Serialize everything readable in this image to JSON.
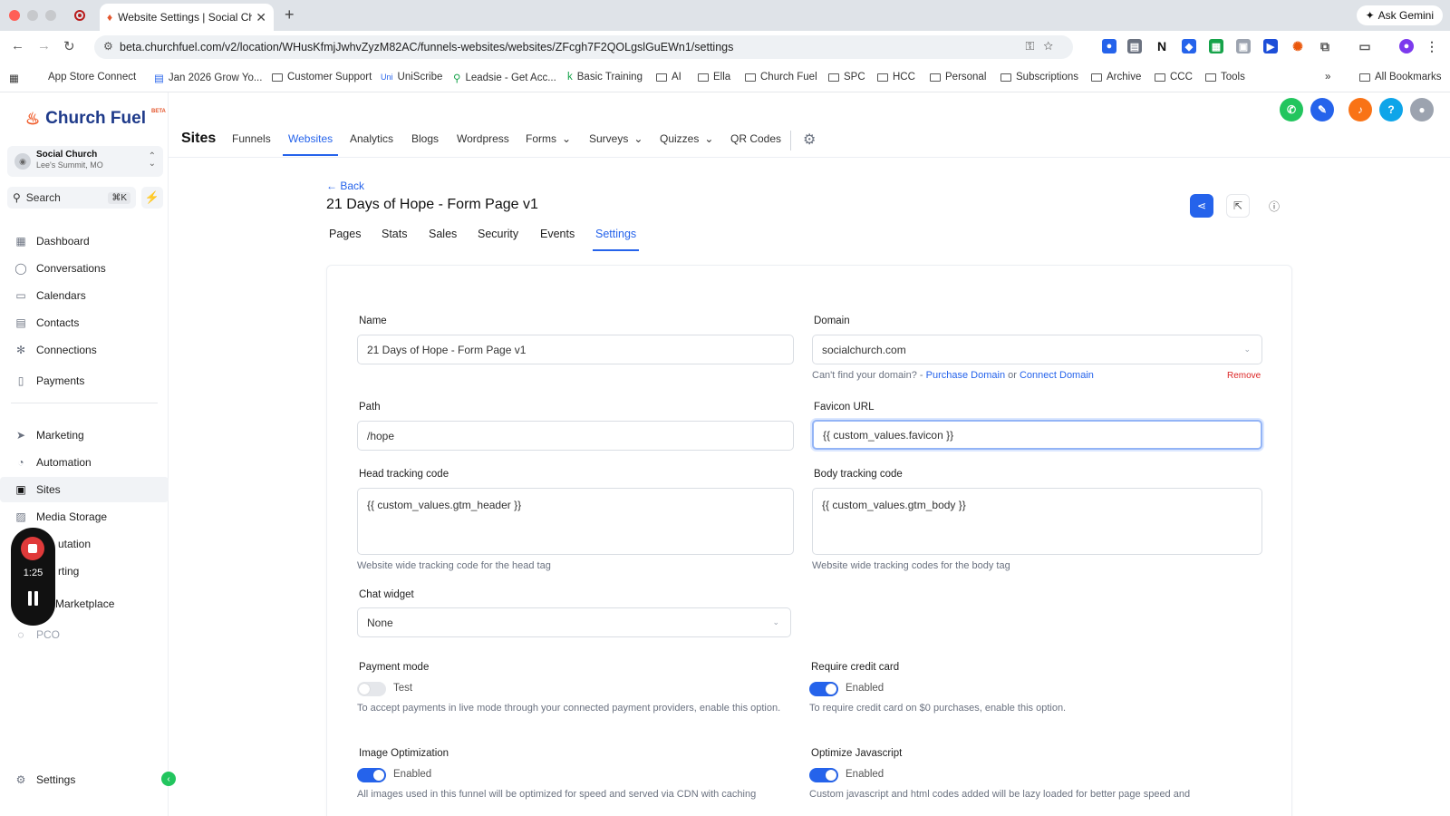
{
  "browser": {
    "tab_title": "Website Settings | Social Ch…",
    "url": "beta.churchfuel.com/v2/location/WHusKfmjJwhvZyzM82AC/funnels-websites/websites/ZFcgh7F2QOLgslGuEWn1/settings",
    "ask_gemini": "Ask Gemini",
    "bookmarks": [
      "App Store Connect",
      "Jan 2026 Grow Yo...",
      "Customer Support",
      "UniScribe",
      "Leadsie - Get Acc...",
      "Basic Training",
      "AI",
      "Ella",
      "Church Fuel",
      "SPC",
      "HCC",
      "Personal",
      "Subscriptions",
      "Archive",
      "CCC",
      "Tools"
    ],
    "all_bookmarks": "All Bookmarks",
    "colors": {
      "close": "#ff5f57",
      "minimize": "#febc2e",
      "maximize": "#28c840"
    }
  },
  "sidebar": {
    "logo": "Church Fuel",
    "logo_badge": "BETA",
    "location_name": "Social Church",
    "location_sub": "Lee's Summit, MO",
    "search_label": "Search",
    "search_shortcut": "⌘K",
    "items": [
      {
        "label": "Dashboard",
        "icon": "dashboard-icon"
      },
      {
        "label": "Conversations",
        "icon": "chat-icon"
      },
      {
        "label": "Calendars",
        "icon": "calendar-icon"
      },
      {
        "label": "Contacts",
        "icon": "contacts-icon"
      },
      {
        "label": "Connections",
        "icon": "connections-icon"
      },
      {
        "label": "Payments",
        "icon": "payments-icon"
      },
      {
        "label": "Marketing",
        "icon": "send-icon"
      },
      {
        "label": "Automation",
        "icon": "automation-icon"
      },
      {
        "label": "Sites",
        "icon": "sites-icon"
      },
      {
        "label": "Media Storage",
        "icon": "media-icon"
      },
      {
        "label": "utation",
        "icon": "reputation-icon"
      },
      {
        "label": "rting",
        "icon": "reporting-icon"
      },
      {
        "label": "Marketplace",
        "icon": "marketplace-icon"
      },
      {
        "label": "PCO",
        "icon": "pco-icon"
      }
    ],
    "settings_label": "Settings"
  },
  "recorder": {
    "time": "1:25"
  },
  "header": {
    "title": "Sites",
    "tabs": [
      "Funnels",
      "Websites",
      "Analytics",
      "Blogs",
      "Wordpress",
      "Forms",
      "Surveys",
      "Quizzes",
      "QR Codes"
    ],
    "active_tab": "Websites",
    "help": "?"
  },
  "page": {
    "back": "Back",
    "title": "21 Days of Hope - Form Page v1",
    "tabs": [
      "Pages",
      "Stats",
      "Sales",
      "Security",
      "Events",
      "Settings"
    ],
    "active_tab": "Settings"
  },
  "form": {
    "name_label": "Name",
    "name_value": "21 Days of Hope - Form Page v1",
    "domain_label": "Domain",
    "domain_value": "socialchurch.com",
    "domain_help_prefix": "Can't find your domain? -",
    "purchase_domain": "Purchase Domain",
    "or": "or",
    "connect_domain": "Connect Domain",
    "remove": "Remove",
    "path_label": "Path",
    "path_value": "/hope",
    "favicon_label": "Favicon URL",
    "favicon_value": "{{ custom_values.favicon }}",
    "head_label": "Head tracking code",
    "head_value": "{{ custom_values.gtm_header }}",
    "head_help": "Website wide tracking code for the head tag",
    "body_label": "Body tracking code",
    "body_value": "{{ custom_values.gtm_body }}",
    "body_help": "Website wide tracking codes for the body tag",
    "chat_label": "Chat widget",
    "chat_value": "None",
    "payment_label": "Payment mode",
    "payment_state": "Test",
    "payment_on": false,
    "payment_desc": "To accept payments in live mode through your connected payment providers, enable this option.",
    "credit_label": "Require credit card",
    "credit_state": "Enabled",
    "credit_on": true,
    "credit_desc": "To require credit card on $0 purchases, enable this option.",
    "imgopt_label": "Image Optimization",
    "imgopt_state": "Enabled",
    "imgopt_on": true,
    "imgopt_desc": "All images used in this funnel will be optimized for speed and served via CDN with caching",
    "js_label": "Optimize Javascript",
    "js_state": "Enabled",
    "js_on": true,
    "js_desc": "Custom javascript and html codes added will be lazy loaded for better page speed and"
  }
}
